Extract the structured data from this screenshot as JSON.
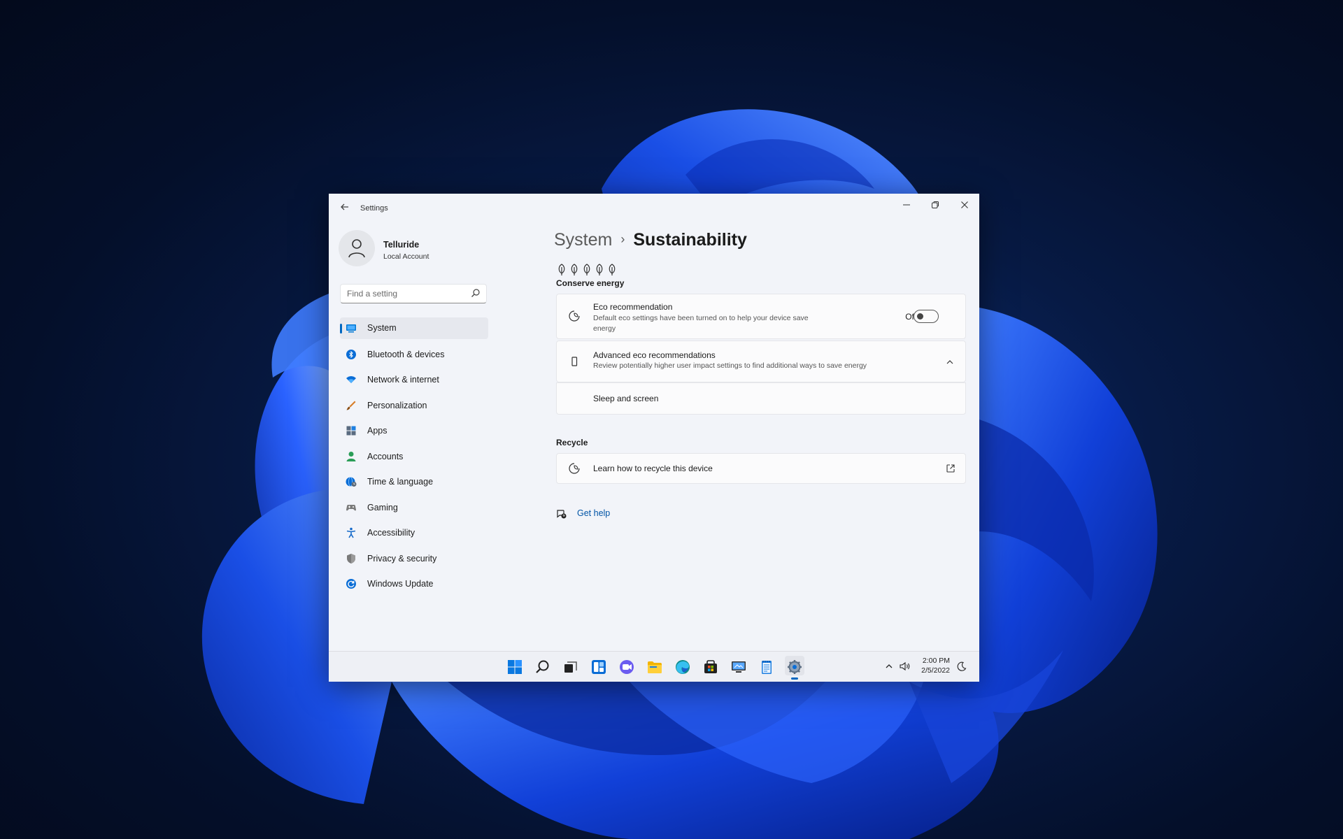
{
  "window": {
    "title": "Settings"
  },
  "profile": {
    "name": "Telluride",
    "account_type": "Local Account"
  },
  "search": {
    "placeholder": "Find a setting"
  },
  "nav": {
    "items": [
      {
        "label": "System",
        "icon": "system-icon",
        "active": true,
        "color": "#0078d4"
      },
      {
        "label": "Bluetooth & devices",
        "icon": "bluetooth-icon",
        "color": "#0a6dd6"
      },
      {
        "label": "Network & internet",
        "icon": "wifi-icon",
        "color": "#0a6dd6"
      },
      {
        "label": "Personalization",
        "icon": "brush-icon",
        "color": "#d77d28"
      },
      {
        "label": "Apps",
        "icon": "apps-icon",
        "color": "#5a6b80"
      },
      {
        "label": "Accounts",
        "icon": "person-icon",
        "color": "#2a9d57"
      },
      {
        "label": "Time & language",
        "icon": "globe-clock-icon",
        "color": "#0a6dd6"
      },
      {
        "label": "Gaming",
        "icon": "gamepad-icon",
        "color": "#7a7a7a"
      },
      {
        "label": "Accessibility",
        "icon": "accessibility-icon",
        "color": "#1469c9"
      },
      {
        "label": "Privacy & security",
        "icon": "shield-icon",
        "color": "#7a7a7a"
      },
      {
        "label": "Windows Update",
        "icon": "refresh-icon",
        "color": "#0a6dd6"
      }
    ]
  },
  "page": {
    "breadcrumb_parent": "System",
    "breadcrumb_separator": "›",
    "title": "Sustainability",
    "leaf_rating": 5
  },
  "conserve": {
    "label": "Conserve energy",
    "eco": {
      "title": "Eco recommendation",
      "description": "Default eco settings have been turned on to help your device save energy",
      "toggle_state": "Off"
    },
    "advanced": {
      "title": "Advanced eco recommendations",
      "description": "Review potentially higher user impact settings to find additional ways to save energy"
    },
    "sleep": {
      "title": "Sleep and screen"
    }
  },
  "recycle": {
    "label": "Recycle",
    "link": "Learn how to recycle this device"
  },
  "help": {
    "label": "Get help"
  },
  "taskbar": {
    "time": "2:00 PM",
    "date": "2/5/2022",
    "accent": "#0067c0"
  }
}
